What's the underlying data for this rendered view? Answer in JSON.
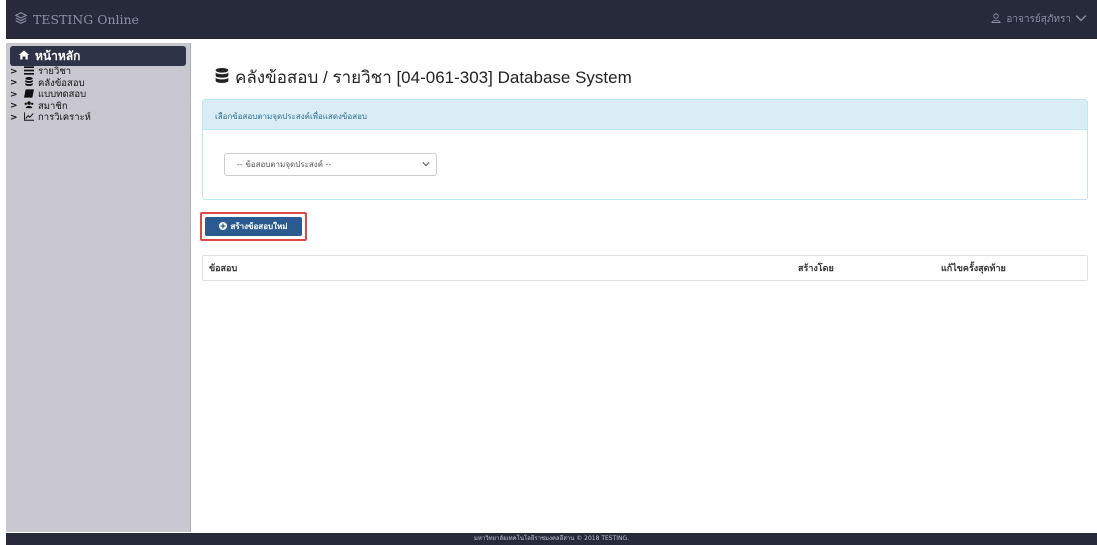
{
  "app": {
    "brand": "TESTING Online",
    "user_name": "อาจารย์สุภัทรา"
  },
  "sidebar": {
    "home_label": "หน้าหลัก",
    "items": [
      {
        "label": "รายวิชา",
        "icon": "list-icon"
      },
      {
        "label": "คลังข้อสอบ",
        "icon": "database-icon"
      },
      {
        "label": "แบบทดสอบ",
        "icon": "book-icon"
      },
      {
        "label": "สมาชิก",
        "icon": "users-icon"
      },
      {
        "label": "การวิเคราะห์",
        "icon": "chart-line-icon"
      }
    ]
  },
  "main": {
    "title": "คลังข้อสอบ / รายวิชา [04-061-303] Database System",
    "panel_heading": "เลือกข้อสอบตามจุดประสงค์เพื่อแสดงข้อสอบ",
    "select_value": "-- ข้อสอบตามจุดประสงค์ --",
    "create_button_label": "สร้างข้อสอบใหม่",
    "table_headers": [
      "ข้อสอบ",
      "สร้างโดย",
      "แก้ไขครั้งสุดท้าย"
    ]
  },
  "footer": {
    "text": "มหาวิทยาลัยเทคโนโลยีราชมงคลอีสาน © 2018 TESTING."
  },
  "colors": {
    "topbar": "#262a3b",
    "sidebar": "#c9c8d1",
    "home_active": "#2f3348",
    "panel_heading_bg": "#d9edf7",
    "primary_button": "#2a5a8f",
    "highlight": "#e04848"
  }
}
